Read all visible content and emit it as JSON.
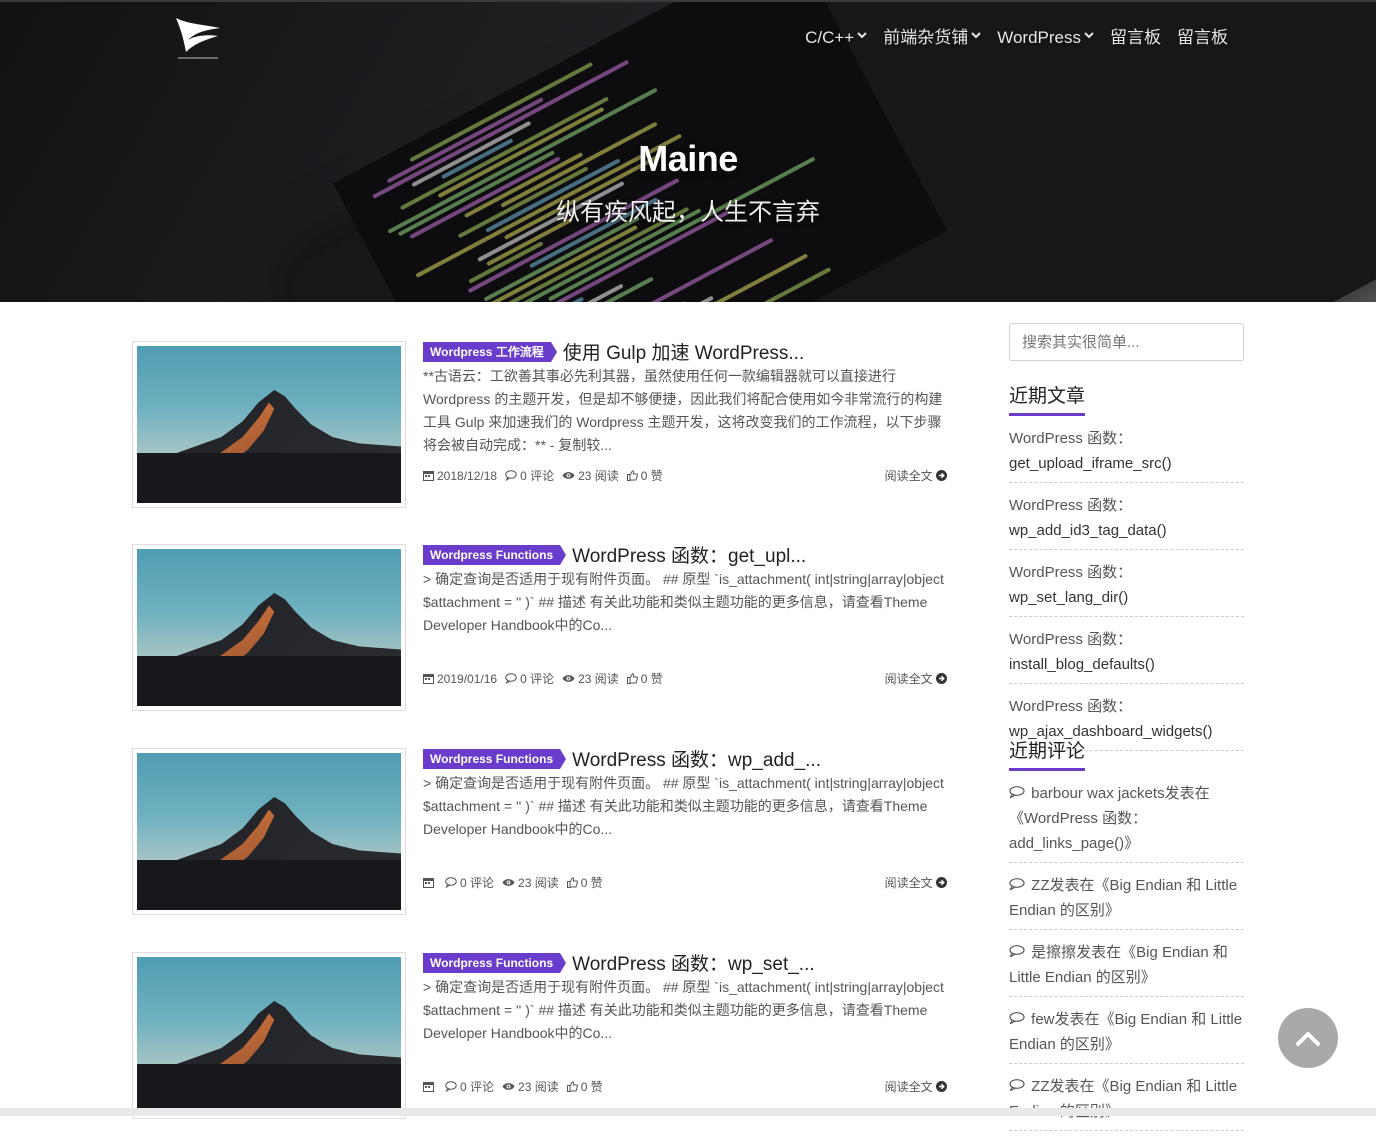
{
  "site": {
    "title": "Maine",
    "subtitle": "纵有疾风起，人生不言弃"
  },
  "nav": [
    {
      "label": "C/C++",
      "dropdown": true
    },
    {
      "label": "前端杂货铺",
      "dropdown": true
    },
    {
      "label": "WordPress",
      "dropdown": true
    },
    {
      "label": "留言板",
      "dropdown": false
    },
    {
      "label": "留言板",
      "dropdown": false
    }
  ],
  "posts": [
    {
      "category": "Wordpress 工作流程",
      "title": "使用 Gulp 加速 WordPress...",
      "excerpt": "**古语云：工欲善其事必先利其器，虽然使用任何一款编辑器就可以直接进行 Wordpress 的主题开发，但是却不够便捷，因此我们将配合使用如今非常流行的构建工具 Gulp 来加速我们的 Wordpress 主题开发，这将改变我们的工作流程，以下步骤将会被自动完成：** - 复制较...",
      "date": "2018/12/18",
      "comments": "0 评论",
      "views": "23 阅读",
      "likes": "0 赞",
      "read_more": "阅读全文"
    },
    {
      "category": "Wordpress Functions",
      "title": "WordPress 函数：get_upl...",
      "excerpt": "> 确定查询是否适用于现有附件页面。 ## 原型 `is_attachment( int|string|array|object $attachment = '' )` ## 描述 有关此功能和类似主题功能的更多信息，请查看Theme Developer Handbook中的Co...",
      "date": "2019/01/16",
      "comments": "0 评论",
      "views": "23 阅读",
      "likes": "0 赞",
      "read_more": "阅读全文"
    },
    {
      "category": "Wordpress Functions",
      "title": "WordPress 函数：wp_add_...",
      "excerpt": "> 确定查询是否适用于现有附件页面。 ## 原型 `is_attachment( int|string|array|object $attachment = '' )` ## 描述 有关此功能和类似主题功能的更多信息，请查看Theme Developer Handbook中的Co...",
      "date": "",
      "comments": "0 评论",
      "views": "23 阅读",
      "likes": "0 赞",
      "read_more": "阅读全文"
    },
    {
      "category": "Wordpress Functions",
      "title": "WordPress 函数：wp_set_...",
      "excerpt": "> 确定查询是否适用于现有附件页面。 ## 原型 `is_attachment( int|string|array|object $attachment = '' )` ## 描述 有关此功能和类似主题功能的更多信息，请查看Theme Developer Handbook中的Co...",
      "date": "",
      "comments": "0 评论",
      "views": "23 阅读",
      "likes": "0 赞",
      "read_more": "阅读全文"
    }
  ],
  "sidebar": {
    "search_placeholder": "搜索其实很简单...",
    "recent_posts_title": "近期文章",
    "recent_posts": [
      {
        "prefix": "WordPress 函数：",
        "fn": "get_upload_iframe_src()"
      },
      {
        "prefix": "WordPress 函数：",
        "fn": "wp_add_id3_tag_data()"
      },
      {
        "prefix": "WordPress 函数：",
        "fn": "wp_set_lang_dir()"
      },
      {
        "prefix": "WordPress 函数：",
        "fn": "install_blog_defaults()"
      },
      {
        "prefix": "WordPress 函数：",
        "fn": "wp_ajax_dashboard_widgets()"
      }
    ],
    "recent_comments_title": "近期评论",
    "recent_comments": [
      {
        "text": "barbour wax jackets发表在《WordPress 函数：add_links_page()》"
      },
      {
        "text": "ZZ发表在《Big Endian 和 Little Endian 的区别》"
      },
      {
        "text": "是擦擦发表在《Big Endian 和 Little Endian 的区别》"
      },
      {
        "text": "few发表在《Big Endian 和 Little Endian 的区别》"
      },
      {
        "text": "ZZ发表在《Big Endian 和 Little Endian 的区别》"
      }
    ]
  },
  "icons": {
    "logo": "bird-logo-icon",
    "calendar": "calendar-icon",
    "comment": "comment-icon",
    "eye": "eye-icon",
    "thumb": "thumbs-up-icon",
    "arrow": "arrow-circle-right-icon",
    "to_top": "chevron-up-icon"
  },
  "colors": {
    "accent": "#6a3ccb",
    "to_top_bg": "#a9a9a9"
  }
}
